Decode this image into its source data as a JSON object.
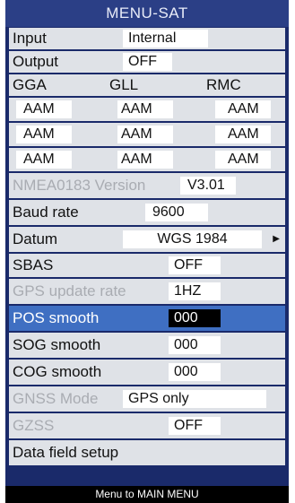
{
  "title": "MENU-SAT",
  "input": {
    "label": "Input",
    "value": "Internal"
  },
  "output": {
    "label": "Output",
    "value": "OFF"
  },
  "sentences": {
    "gga": "GGA",
    "gll": "GLL",
    "rmc": "RMC"
  },
  "talker_rows": [
    [
      "AAM",
      "AAM",
      "AAM"
    ],
    [
      "AAM",
      "AAM",
      "AAM"
    ],
    [
      "AAM",
      "AAM",
      "AAM"
    ]
  ],
  "nmea_version": {
    "label": "NMEA0183 Version",
    "value": "V3.01"
  },
  "baud_rate": {
    "label": "Baud rate",
    "value": "9600"
  },
  "datum": {
    "label": "Datum",
    "value": "WGS 1984"
  },
  "sbas": {
    "label": "SBAS",
    "value": "OFF"
  },
  "gps_update_rate": {
    "label": "GPS update rate",
    "value": "1HZ"
  },
  "pos_smooth": {
    "label": "POS smooth",
    "value": "000"
  },
  "sog_smooth": {
    "label": "SOG smooth",
    "value": "000"
  },
  "cog_smooth": {
    "label": "COG smooth",
    "value": "000"
  },
  "gnss_mode": {
    "label": "GNSS Mode",
    "value": "GPS only"
  },
  "gzss": {
    "label": "GZSS",
    "value": "OFF"
  },
  "data_field_setup": {
    "label": "Data field setup"
  },
  "footer": "Menu to MAIN MENU",
  "colors": {
    "title_bar": "#2b3f86",
    "frame": "#1a2a6a",
    "row": "#dfe2e7",
    "selected_row": "#3f6fc2",
    "disabled_text": "#a9acb2"
  }
}
